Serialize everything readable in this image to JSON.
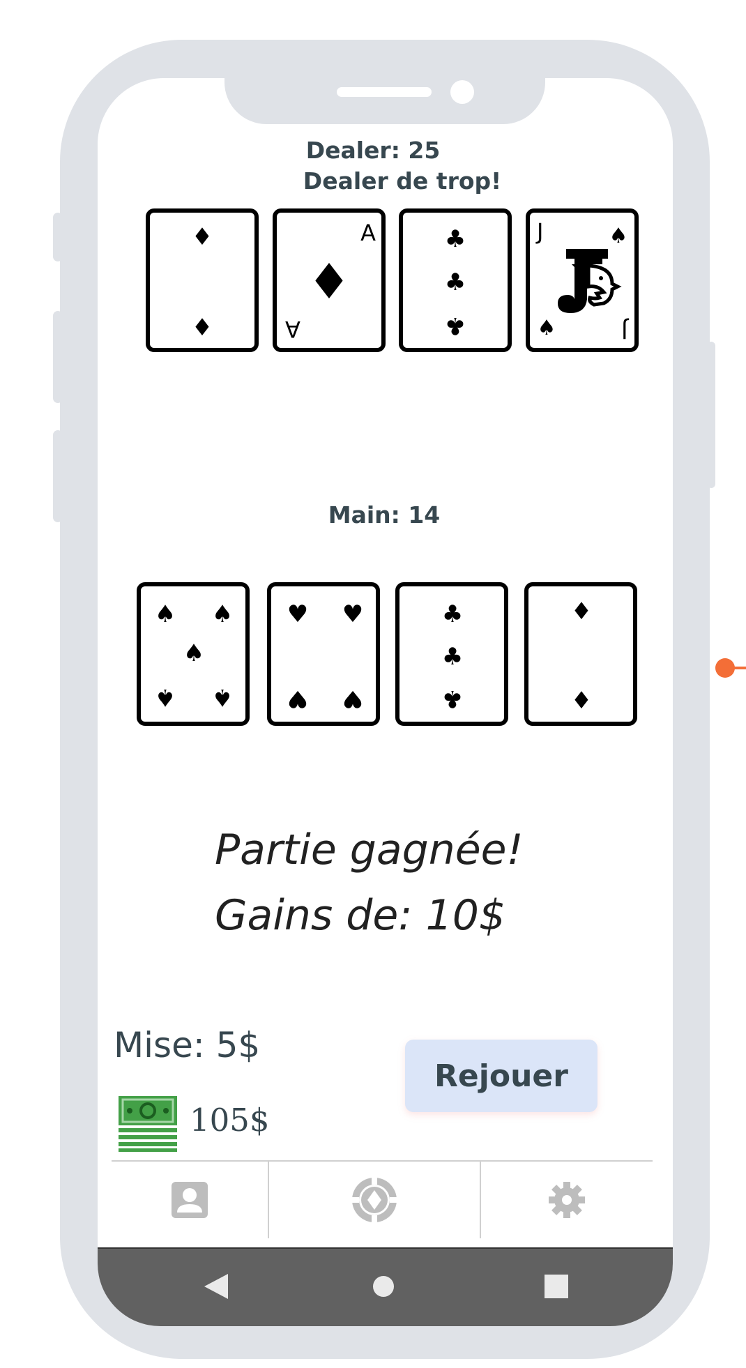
{
  "dealer": {
    "score_label": "Dealer: 25",
    "status": "Dealer de trop!",
    "cards": [
      {
        "rank": "2",
        "suit": "diamond"
      },
      {
        "rank": "A",
        "suit": "diamond"
      },
      {
        "rank": "3",
        "suit": "club"
      },
      {
        "rank": "J",
        "suit": "spade"
      }
    ]
  },
  "player": {
    "score_label": "Main: 14",
    "cards": [
      {
        "rank": "5",
        "suit": "spade"
      },
      {
        "rank": "4",
        "suit": "heart"
      },
      {
        "rank": "3",
        "suit": "club"
      },
      {
        "rank": "2",
        "suit": "diamond"
      }
    ]
  },
  "result": {
    "line1": "Partie gagnée!",
    "line2": "Gains de: 10$"
  },
  "bet_label": "Mise: 5$",
  "balance": "105$",
  "replay_label": "Rejouer",
  "tabs": [
    {
      "icon": "profile-icon"
    },
    {
      "icon": "poker-chip-icon"
    },
    {
      "icon": "gear-icon"
    }
  ],
  "nav_buttons": [
    {
      "icon": "back-triangle-icon"
    },
    {
      "icon": "home-circle-icon"
    },
    {
      "icon": "recents-square-icon"
    }
  ],
  "colors": {
    "frame": "#dfe2e7",
    "text_primary": "#37474f",
    "replay_bg": "#dbe5f8",
    "money_green": "#43a047",
    "nav_bar": "#616161",
    "accent_dot": "#f36e37"
  }
}
